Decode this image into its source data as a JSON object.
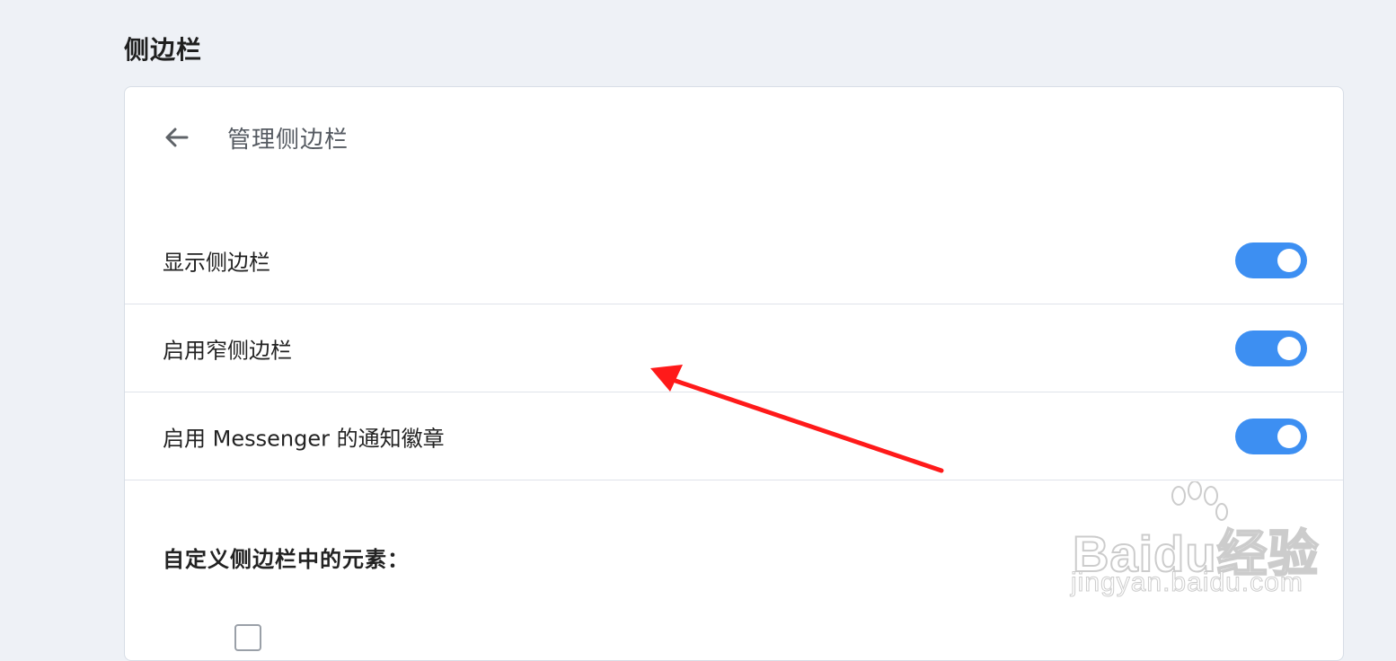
{
  "page": {
    "section_title": "侧边栏"
  },
  "header": {
    "back_icon": "arrow-left-icon",
    "title": "管理侧边栏"
  },
  "settings": [
    {
      "label": "显示侧边栏",
      "enabled": true
    },
    {
      "label": "启用窄侧边栏",
      "enabled": true
    },
    {
      "label": "启用 Messenger 的通知徽章",
      "enabled": true
    }
  ],
  "customize": {
    "heading": "自定义侧边栏中的元素："
  },
  "annotation": {
    "arrow_color": "#ff1a1a"
  },
  "watermark": {
    "brand": "Baidu经验",
    "url": "jingyan.baidu.com"
  },
  "colors": {
    "background": "#eef1f6",
    "card": "#ffffff",
    "toggle_on": "#3d8ff2"
  }
}
